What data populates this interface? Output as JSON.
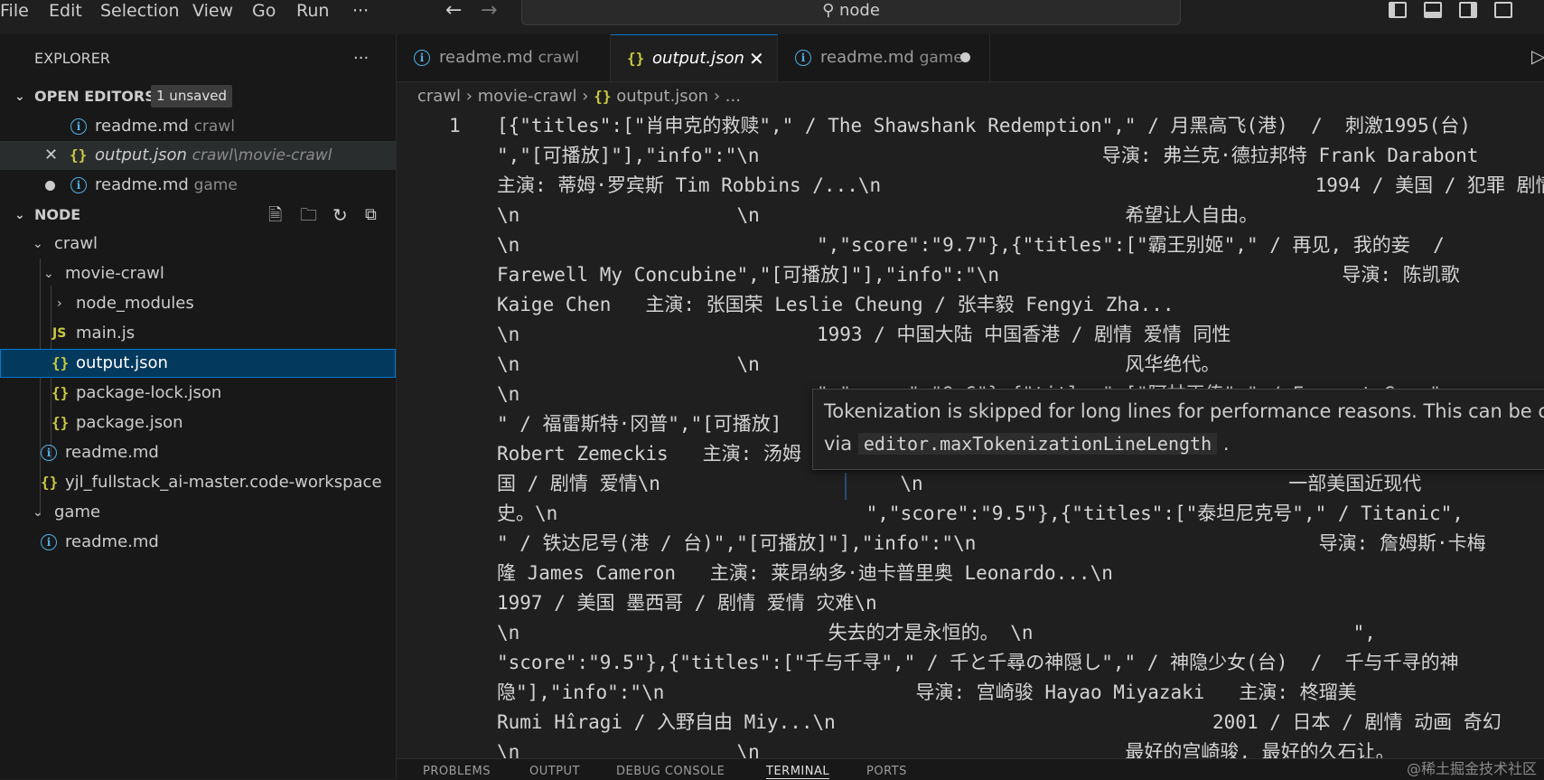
{
  "menu": [
    "File",
    "Edit",
    "Selection",
    "View",
    "Go",
    "Run",
    "···"
  ],
  "command_center": "node",
  "explorer": {
    "title": "EXPLORER",
    "more": "···",
    "open_editors": {
      "label": "OPEN EDITORS",
      "badge": "1 unsaved",
      "items": [
        {
          "name": "readme.md",
          "desc": "crawl"
        },
        {
          "name": "output.json",
          "desc": "crawl\\movie-crawl"
        },
        {
          "name": "readme.md",
          "desc": "game"
        }
      ]
    },
    "folder": {
      "label": "NODE",
      "items": [
        "crawl",
        "movie-crawl",
        "node_modules",
        "main.js",
        "output.json",
        "package-lock.json",
        "package.json",
        "readme.md",
        "yjl_fullstack_ai-master.code-workspace",
        "game",
        "readme.md"
      ]
    }
  },
  "tabs": [
    {
      "name": "readme.md",
      "desc": "crawl"
    },
    {
      "name": "output.json",
      "desc": ""
    },
    {
      "name": "readme.md",
      "desc": "game"
    }
  ],
  "breadcrumb": {
    "p1": "crawl",
    "p2": "movie-crawl",
    "p3": "output.json",
    "p4": "..."
  },
  "editor": {
    "line_number": "1",
    "lines": [
      "[{\"titles\":[\"肖申克的救赎\",\" / The Shawshank Redemption\",\" / 月黑高飞(港)  /  刺激1995(台)",
      "\",\"[可播放]\"],\"info\":\"\\n                              导演: 弗兰克·德拉邦特 Frank Darabont",
      "主演: 蒂姆·罗宾斯 Tim Robbins /...\\n                                      1994 / 美国 / 犯罪 剧情",
      "\\n                   \\n                                希望让人自由。",
      "\\n                          \",\"score\":\"9.7\"},{\"titles\":[\"霸王别姬\",\" / 再见, 我的妾  /",
      "Farewell My Concubine\",\"[可播放]\"],\"info\":\"\\n                              导演: 陈凯歌",
      "Kaige Chen   主演: 张国荣 Leslie Cheung / 张丰毅 Fengyi Zha...",
      "\\n                          1993 / 中国大陆 中国香港 / 剧情 爱情 同性",
      "\\n                   \\n                                风华绝代。",
      "\\n                          \",\"score\":\"9.6\"},{\"titles\":[\"阿甘正传\",\" / Forrest Gump\",",
      "\" / 福雷斯特·冈普\",\"[可播放]",
      "Robert Zemeckis   主演: 汤姆",
      "国 / 剧情 爱情\\n                     \\n                                一部美国近现代",
      "史。\\n                           \",\"score\":\"9.5\"},{\"titles\":[\"泰坦尼克号\",\" / Titanic\",",
      "\" / 铁达尼号(港 / 台)\",\"[可播放]\"],\"info\":\"\\n                              导演: 詹姆斯·卡梅",
      "隆 James Cameron   主演: 莱昂纳多·迪卡普里奥 Leonardo...\\n",
      "1997 / 美国 墨西哥 / 剧情 爱情 灾难\\n",
      "\\n                           失去的才是永恒的。 \\n                            \",",
      "\"score\":\"9.5\"},{\"titles\":[\"千与千寻\",\" / 千と千尋の神隠し\",\" / 神隐少女(台)  /  千与千寻的神",
      "隐\"],\"info\":\"\\n                      导演: 宫崎骏 Hayao Miyazaki   主演: 柊瑠美",
      "Rumi Hîragi / 入野自由 Miy...\\n                                 2001 / 日本 / 剧情 动画 奇幻",
      "\\n                   \\n                                最好的宫崎骏, 最好的久石让。"
    ]
  },
  "hover": {
    "line1": "Tokenization is skipped for long lines for performance reasons. This can be c",
    "line2_prefix": "via",
    "line2_code": "editor.maxTokenizationLineLength",
    "line2_suffix": "."
  },
  "panel_tabs": [
    "PROBLEMS",
    "OUTPUT",
    "DEBUG CONSOLE",
    "TERMINAL",
    "PORTS"
  ],
  "watermark": "@稀土掘金技术社区",
  "colors": {
    "accent": "#0078d4",
    "selection": "#04395e",
    "json_icon": "#cbcb41",
    "info_icon": "#4fb0e8"
  }
}
